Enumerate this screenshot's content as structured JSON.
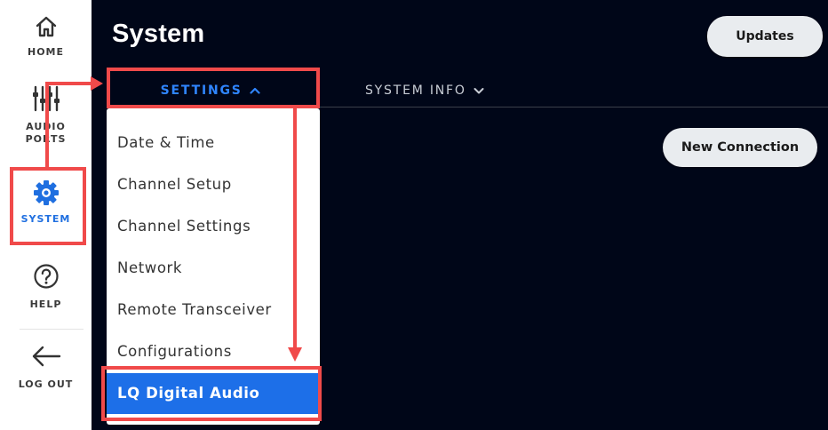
{
  "sidebar": {
    "items": [
      {
        "label": "HOME",
        "icon": "home-icon"
      },
      {
        "label": "AUDIO PORTS",
        "icon": "audio-ports-icon"
      },
      {
        "label": "SYSTEM",
        "icon": "gear-icon",
        "active": true
      },
      {
        "label": "HELP",
        "icon": "help-icon"
      },
      {
        "label": "LOG OUT",
        "icon": "arrow-left-icon"
      }
    ]
  },
  "header": {
    "title": "System",
    "updates_label": "Updates"
  },
  "tabs": [
    {
      "label": "SETTINGS",
      "chevron": "up",
      "active": true
    },
    {
      "label": "SYSTEM INFO",
      "chevron": "down",
      "active": false
    }
  ],
  "new_connection_label": "New Connection",
  "dropdown": {
    "items": [
      {
        "label": "Date & Time"
      },
      {
        "label": "Channel Setup"
      },
      {
        "label": "Channel Settings"
      },
      {
        "label": "Network"
      },
      {
        "label": "Remote Transceiver"
      },
      {
        "label": "Configurations"
      },
      {
        "label": "LQ Digital Audio",
        "selected": true
      }
    ]
  },
  "colors": {
    "panel_bg": "#000618",
    "accent_blue": "#1f6fe0",
    "annotation_red": "#f04a4a"
  }
}
